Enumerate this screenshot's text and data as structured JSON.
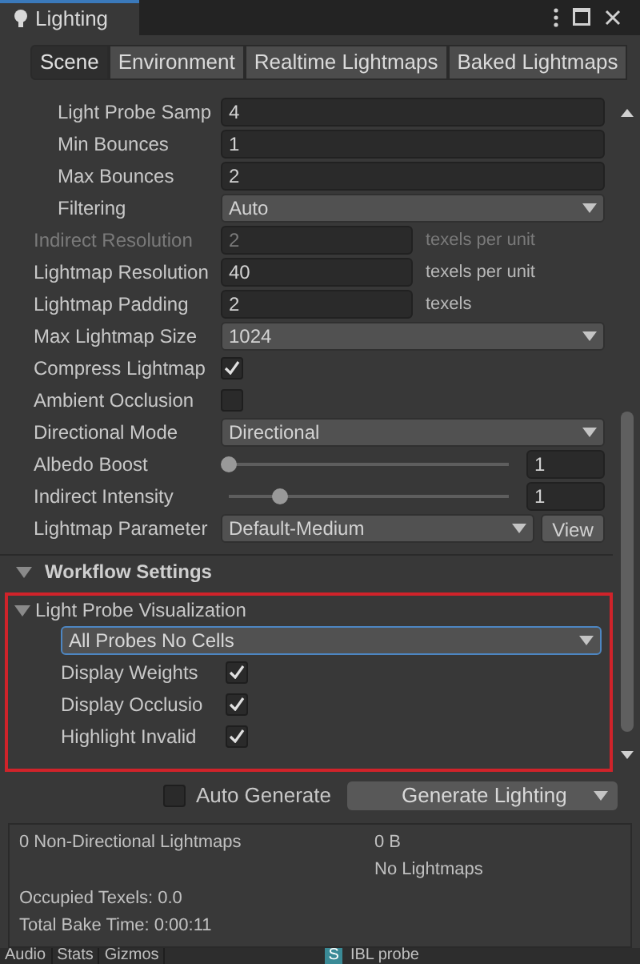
{
  "window": {
    "title": "Lighting"
  },
  "tabs": [
    {
      "label": "Scene",
      "selected": true
    },
    {
      "label": "Environment",
      "selected": false
    },
    {
      "label": "Realtime Lightmaps",
      "selected": false
    },
    {
      "label": "Baked Lightmaps",
      "selected": false
    }
  ],
  "sub_rows": [
    {
      "kind": "number",
      "label": "Light Probe Samp",
      "value": "4",
      "disabled": false
    },
    {
      "kind": "number",
      "label": "Min Bounces",
      "value": "1",
      "disabled": false
    },
    {
      "kind": "number",
      "label": "Max Bounces",
      "value": "2",
      "disabled": false
    },
    {
      "kind": "dropdown",
      "label": "Filtering",
      "value": "Auto",
      "disabled": false
    }
  ],
  "rows": [
    {
      "kind": "number",
      "label": "Indirect Resolution",
      "value": "2",
      "suffix": "texels per unit",
      "disabled": true
    },
    {
      "kind": "number",
      "label": "Lightmap Resolution",
      "value": "40",
      "suffix": "texels per unit",
      "disabled": false
    },
    {
      "kind": "number",
      "label": "Lightmap Padding",
      "value": "2",
      "suffix": "texels",
      "disabled": false
    },
    {
      "kind": "dropdown",
      "label": "Max Lightmap Size",
      "value": "1024",
      "disabled": false
    },
    {
      "kind": "checkbox",
      "label": "Compress Lightmap",
      "checked": true,
      "disabled": false
    },
    {
      "kind": "checkbox",
      "label": "Ambient Occlusion",
      "checked": false,
      "disabled": false
    },
    {
      "kind": "dropdown",
      "label": "Directional Mode",
      "value": "Directional",
      "disabled": false
    },
    {
      "kind": "slider",
      "label": "Albedo Boost",
      "level": 0,
      "value": "1",
      "disabled": false
    },
    {
      "kind": "slider",
      "label": "Indirect Intensity",
      "level": 0.18,
      "value": "1",
      "disabled": false
    },
    {
      "kind": "dropdown_button",
      "label": "Lightmap Parameter",
      "value": "Default-Medium",
      "button": "View",
      "disabled": false
    }
  ],
  "workflow": {
    "title": "Workflow Settings",
    "expanded": true
  },
  "visualization": {
    "title": "Light Probe Visualization",
    "expanded": true,
    "mode": "All Probes No Cells",
    "options": [
      {
        "label": "Display Weights",
        "checked": true
      },
      {
        "label": "Display Occlusio",
        "checked": true
      },
      {
        "label": "Highlight Invalid",
        "checked": true
      }
    ]
  },
  "generate": {
    "auto_label": "Auto Generate",
    "auto_checked": false,
    "button": "Generate Lighting"
  },
  "stats": {
    "lightmaps": "0 Non-Directional Lightmaps",
    "size": "0 B",
    "preview": "No Lightmaps",
    "texels": "Occupied Texels: 0.0",
    "bake_time": "Total Bake Time: 0:00:11"
  },
  "bottom_tabs": [
    "Audio",
    "Stats",
    "Gizmos"
  ],
  "bottom_object": {
    "badge": "S",
    "name": "IBL probe"
  }
}
